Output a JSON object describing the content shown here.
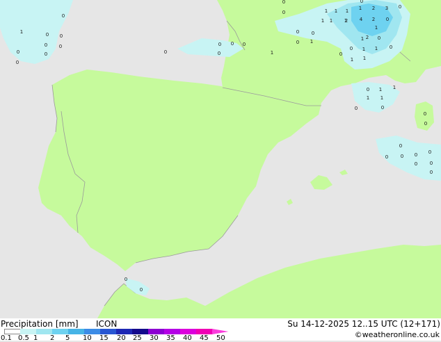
{
  "title": "Precipitation [mm]",
  "model": "ICON",
  "valid_time": "Su 14-12-2025 12..15 UTC (12+171)",
  "credit": "©weatheronline.co.uk",
  "legend": {
    "ticks": [
      "0.1",
      "0.5",
      "1",
      "2",
      "5",
      "10",
      "15",
      "20",
      "25",
      "30",
      "35",
      "40",
      "45",
      "50"
    ],
    "colors": [
      "#ffffff",
      "#c8f4f4",
      "#a0e6f0",
      "#6ed2f0",
      "#46b4e6",
      "#3c8ce6",
      "#2856d2",
      "#1e28b4",
      "#140a8c",
      "#8c00d2",
      "#b400e6",
      "#dc00dc",
      "#f000b4",
      "#fa3cdc"
    ]
  },
  "colors": {
    "sea": "#e6e6e6",
    "land": "#c6fa9c",
    "border": "#9a9a9a",
    "precip_light": "#c8f4f4",
    "precip_medium": "#a0e6f0",
    "precip_heavy": "#6ed2f0"
  },
  "map_labels": [
    "0",
    "1",
    "0",
    "0",
    "0",
    "0",
    "0",
    "0",
    "0",
    "0",
    "0",
    "0",
    "0",
    "0",
    "1",
    "1",
    "1",
    "1",
    "0",
    "1",
    "1",
    "2",
    "3",
    "0",
    "1",
    "1",
    "2",
    "4",
    "2",
    "0",
    "0",
    "1",
    "2",
    "0",
    "1",
    "1",
    "0",
    "0",
    "1",
    "1",
    "0",
    "1",
    "1",
    "0",
    "1",
    "1",
    "1",
    "1",
    "0",
    "0",
    "0",
    "0",
    "0",
    "0",
    "0",
    "0",
    "0",
    "0",
    "0",
    "0",
    "0",
    "0",
    "0",
    "0",
    "0",
    "0"
  ]
}
